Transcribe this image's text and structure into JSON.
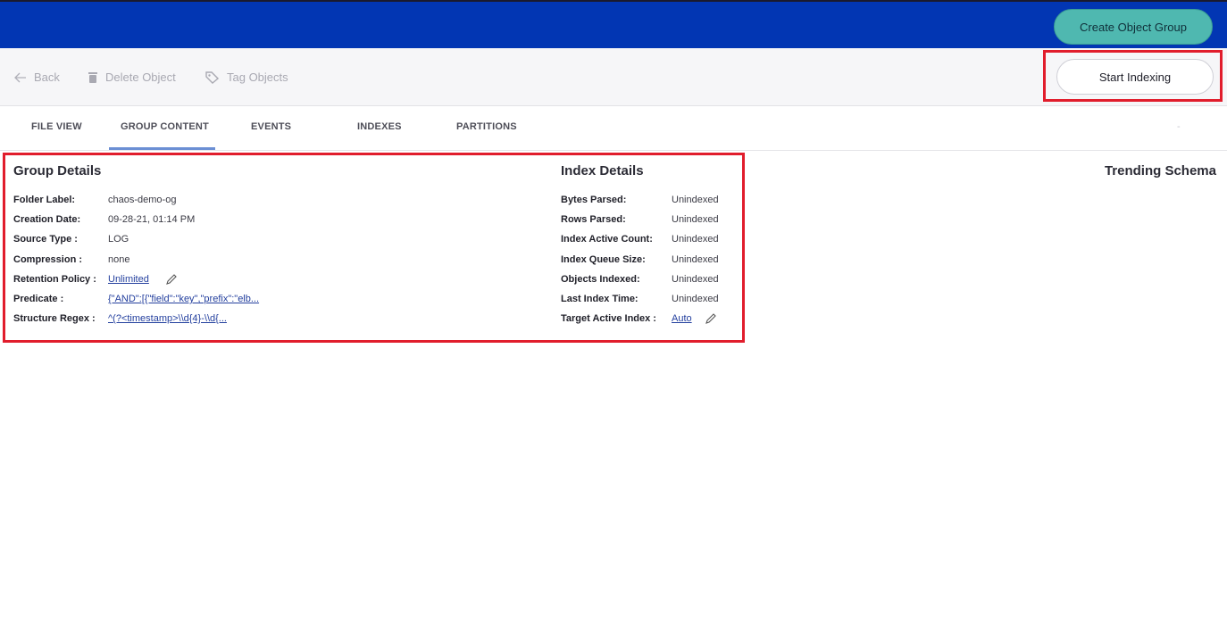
{
  "header": {
    "create_button": "Create Object Group"
  },
  "toolbar": {
    "back_label": "Back",
    "delete_label": "Delete Object",
    "tag_label": "Tag Objects",
    "start_indexing_label": "Start Indexing"
  },
  "tabs": [
    {
      "label": "FILE VIEW"
    },
    {
      "label": "GROUP CONTENT",
      "active": true
    },
    {
      "label": "EVENTS"
    },
    {
      "label": "INDEXES"
    },
    {
      "label": "PARTITIONS"
    }
  ],
  "tabs_extra": "-",
  "group_details": {
    "title": "Group Details",
    "rows": [
      {
        "label": "Folder Label:",
        "value": "chaos-demo-og"
      },
      {
        "label": "Creation Date:",
        "value": "09-28-21, 01:14 PM"
      },
      {
        "label": "Source Type :",
        "value": "LOG"
      },
      {
        "label": "Compression :",
        "value": "none"
      },
      {
        "label": "Retention Policy :",
        "value": "Unlimited"
      },
      {
        "label": "Predicate :",
        "value": "{\"AND\":[{\"field\":\"key\",\"prefix\":\"elb..."
      },
      {
        "label": "Structure Regex :",
        "value": "^(?<timestamp>\\\\d{4}-\\\\d{..."
      }
    ]
  },
  "index_details": {
    "title": "Index Details",
    "rows": [
      {
        "label": "Bytes Parsed:",
        "value": "Unindexed"
      },
      {
        "label": "Rows Parsed:",
        "value": "Unindexed"
      },
      {
        "label": "Index Active Count:",
        "value": "Unindexed"
      },
      {
        "label": "Index Queue Size:",
        "value": "Unindexed"
      },
      {
        "label": "Objects Indexed:",
        "value": "Unindexed"
      },
      {
        "label": "Last Index Time:",
        "value": "Unindexed"
      },
      {
        "label": "Target Active Index :",
        "value": "Auto"
      }
    ]
  },
  "trending_schema": {
    "title": "Trending Schema"
  },
  "colors": {
    "header_bg": "#0236b3",
    "create_button_bg": "#4fb8b0",
    "highlight_border": "#e11d2c",
    "link": "#233f9e",
    "active_tab_underline": "#6b8fd4"
  }
}
